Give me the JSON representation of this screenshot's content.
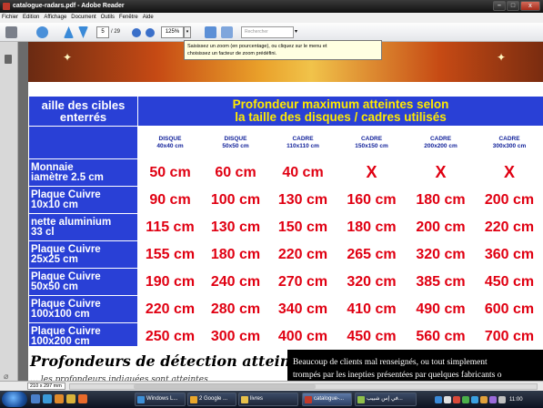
{
  "window": {
    "title": "catalogue-radars.pdf - Adobe Reader"
  },
  "window_controls": {
    "minimize": "–",
    "maximize": "□",
    "close": "x"
  },
  "menu": [
    "Fichier",
    "Edition",
    "Affichage",
    "Document",
    "Outils",
    "Fenêtre",
    "Aide"
  ],
  "toolbar": {
    "page_current": "5",
    "page_total": "/ 29",
    "zoom": "125%",
    "search_placeholder": "Rechercher",
    "dropdown_arrow": "▾"
  },
  "tooltip": {
    "line1": "Saisissez un zoom (en pourcentage), ou cliquez sur le menu et",
    "line2": "choisissez un facteur de zoom prédéfini."
  },
  "table": {
    "header_left_line1": "aille des cibles",
    "header_left_line2": "enterrés",
    "header_main_line1": "Profondeur maximum atteintes selon",
    "header_main_line2": "la taille des disques / cadres utilisés",
    "columns": [
      {
        "line1": "DISQUE",
        "line2": "40x40 cm"
      },
      {
        "line1": "DISQUE",
        "line2": "50x50 cm"
      },
      {
        "line1": "CADRE",
        "line2": "110x110 cm"
      },
      {
        "line1": "CADRE",
        "line2": "150x150 cm"
      },
      {
        "line1": "CADRE",
        "line2": "200x200 cm"
      },
      {
        "line1": "CADRE",
        "line2": "300x300 cm"
      }
    ],
    "rows": [
      {
        "line1": "Monnaie",
        "line2": "iamètre 2.5 cm",
        "values": [
          "50 cm",
          "60 cm",
          "40 cm",
          "X",
          "X",
          "X"
        ]
      },
      {
        "line1": "Plaque Cuivre",
        "line2": "10x10 cm",
        "values": [
          "90 cm",
          "100 cm",
          "130 cm",
          "160 cm",
          "180 cm",
          "200 cm"
        ]
      },
      {
        "line1": "nette aluminium",
        "line2": "33 cl",
        "values": [
          "115 cm",
          "130 cm",
          "150 cm",
          "180 cm",
          "200 cm",
          "220 cm"
        ]
      },
      {
        "line1": "Plaque Cuivre",
        "line2": "25x25 cm",
        "values": [
          "155 cm",
          "180 cm",
          "220 cm",
          "265 cm",
          "320 cm",
          "360 cm"
        ]
      },
      {
        "line1": "Plaque Cuivre",
        "line2": "50x50 cm",
        "values": [
          "190 cm",
          "240 cm",
          "270 cm",
          "320 cm",
          "385 cm",
          "450 cm"
        ]
      },
      {
        "line1": "Plaque Cuivre",
        "line2": "100x100 cm",
        "values": [
          "220 cm",
          "280 cm",
          "340 cm",
          "410 cm",
          "490 cm",
          "600 cm"
        ]
      },
      {
        "line1": "Plaque Cuivre",
        "line2": "100x200 cm",
        "values": [
          "250 cm",
          "300 cm",
          "400 cm",
          "450 cm",
          "560 cm",
          "700 cm"
        ]
      }
    ]
  },
  "footer": {
    "script_title": "Profondeurs de détection atteintes…",
    "script_sub": "… les profondeurs indiquées sont atteintes",
    "paragraph_line1": "Beaucoup de clients mal renseignés, ou tout simplement",
    "paragraph_line2": "trompés par les inepties présentées par quelques fabricants o"
  },
  "statusbar": {
    "page_size": "210 x 297 mm"
  },
  "taskbar": {
    "tasks": [
      {
        "label": "Windows L...",
        "color": "#3d8fd6"
      },
      {
        "label": "2 Google ...",
        "color": "#e9a62a"
      },
      {
        "label": "livres",
        "color": "#e6c04a"
      },
      {
        "label": "catalogue-...",
        "color": "#c0392b",
        "active": true
      },
      {
        "label": "في إس شبيب...",
        "color": "#8fc04a"
      }
    ],
    "clock": "11:00"
  },
  "colors": {
    "table_header_bg": "#2940d6",
    "table_value": "#e00012",
    "header_main_text": "#ffea00"
  }
}
